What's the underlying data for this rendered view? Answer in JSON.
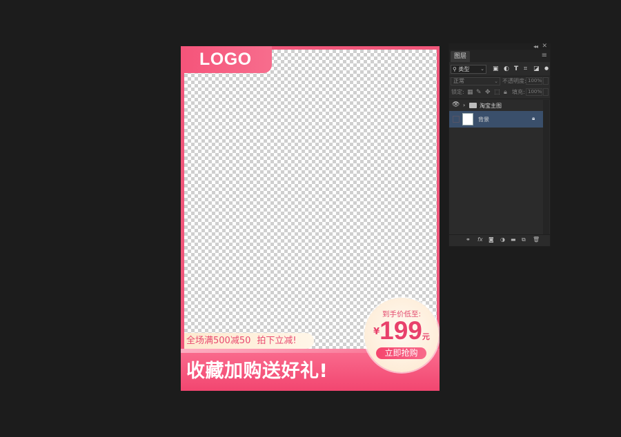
{
  "canvas": {
    "logo_text": "LOGO",
    "promo_text_1": "全场满500减50",
    "promo_text_2": "拍下立减!",
    "slogan": "收藏加购送好礼!",
    "price_caption": "到手价低至:",
    "price_currency": "¥",
    "price_value": "199",
    "price_unit": "元",
    "buy_button": "立即抢购",
    "colors": {
      "accent": "#f0567a",
      "accent_light": "#fa6d8f",
      "cream": "#fde9cf"
    }
  },
  "layers_panel": {
    "tab": "图层",
    "filter_kind": "类型",
    "blend_mode": "正常",
    "opacity_label": "不透明度:",
    "opacity_value": "100%",
    "lock_label": "锁定:",
    "fill_label": "填充:",
    "fill_value": "100%",
    "layers": [
      {
        "name": "淘宝主图",
        "type": "group",
        "visible": true,
        "selected": false
      },
      {
        "name": "背景",
        "type": "layer",
        "visible": false,
        "selected": true,
        "locked": true
      }
    ],
    "filter_icons": [
      "image-filter-icon",
      "adjustment-filter-icon",
      "text-filter-icon",
      "shape-filter-icon",
      "smart-object-filter-icon"
    ],
    "bottom_icons": [
      "link-icon",
      "fx-icon",
      "mask-icon",
      "adjustment-icon",
      "group-folder-icon",
      "new-layer-icon",
      "trash-icon"
    ]
  }
}
